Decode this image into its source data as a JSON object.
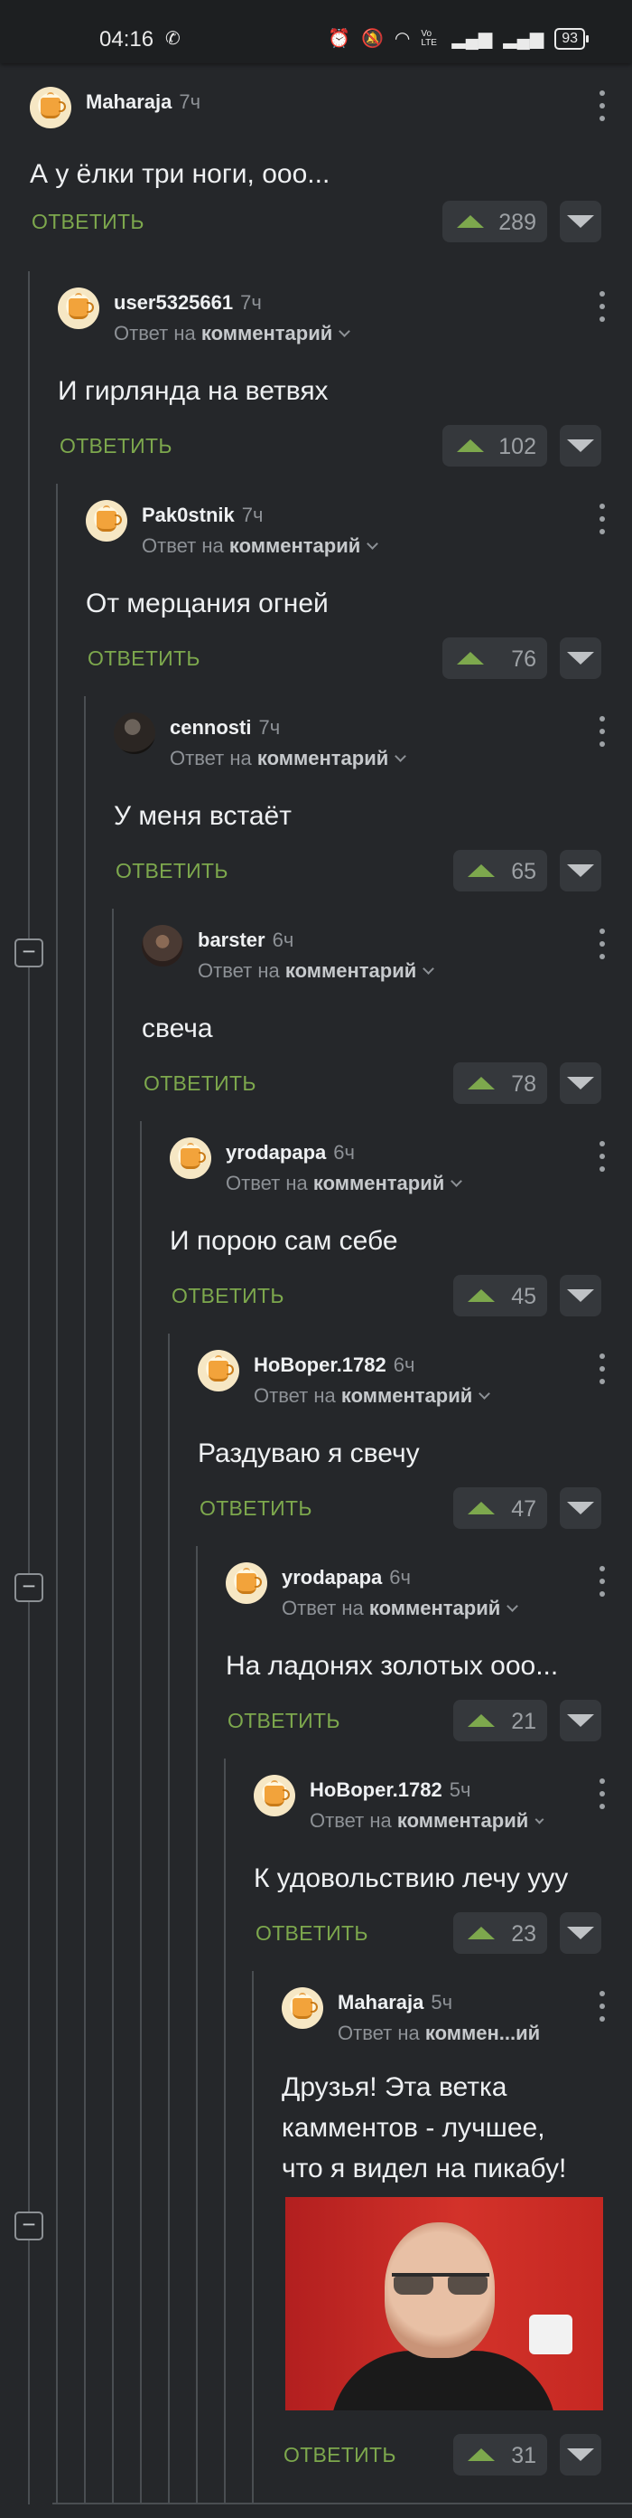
{
  "status_bar": {
    "time": "04:16",
    "icons": [
      "call-icon",
      "alarm-icon",
      "mute-icon",
      "wifi-icon",
      "volte-icon",
      "signal-icon",
      "signal-icon"
    ],
    "volte_label": "Vo LTE",
    "battery": "93"
  },
  "colors": {
    "accent_green": "#7da84d",
    "background": "#25272a"
  },
  "reply_prefix": "Ответ на",
  "reply_target": "комментарий",
  "reply_label": "ОТВЕТИТЬ",
  "comments": [
    {
      "user": "Maharaja",
      "time": "7ч",
      "text": "А у ёлки три ноги, ооо...",
      "votes": "289"
    },
    {
      "user": "user5325661",
      "time": "7ч",
      "text": "И гирлянда на ветвях",
      "votes": "102"
    },
    {
      "user": "Pak0stnik",
      "time": "7ч",
      "text": "От мерцания огней",
      "votes": "76"
    },
    {
      "user": "cennosti",
      "time": "7ч",
      "text": "У меня встаёт",
      "votes": "65"
    },
    {
      "user": "barster",
      "time": "6ч",
      "text": "свеча",
      "votes": "78"
    },
    {
      "user": "yrodapapa",
      "time": "6ч",
      "text": "И порою сам себе",
      "votes": "45"
    },
    {
      "user": "НоBoper.1782",
      "time": "6ч",
      "text": "Раздуваю я свечу",
      "votes": "47"
    },
    {
      "user": "yrodapapa",
      "time": "6ч",
      "text": "На ладонях золотых ооо...",
      "votes": "21"
    },
    {
      "user": "НоBoper.1782",
      "time": "5ч",
      "text": "К удовольствию лечу ууу",
      "votes": "23"
    },
    {
      "user": "Maharaja",
      "time": "5ч",
      "reply_target_short": "коммен...ий",
      "text": "Друзья! Эта ветка камментов - лучшее, что я видел на пикабу!",
      "votes": "31"
    }
  ]
}
